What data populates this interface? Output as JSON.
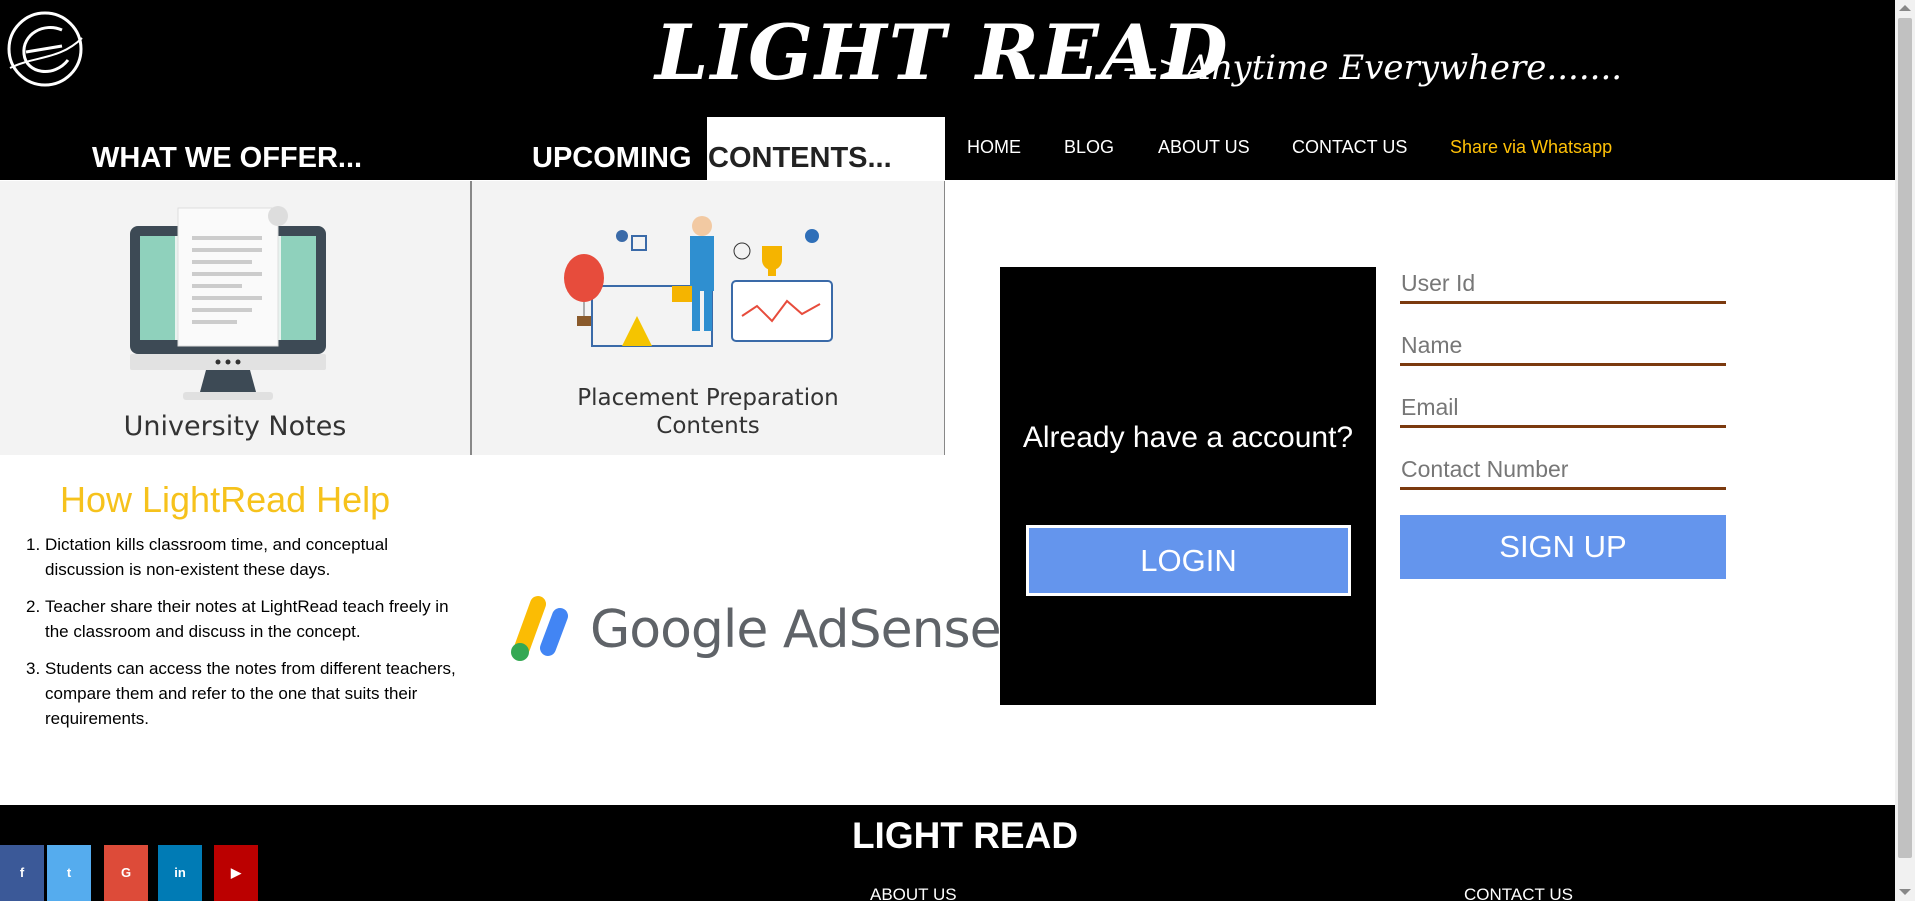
{
  "header": {
    "brand": "LIGHT READ",
    "tagline": "--->Anytime Everywhere.......",
    "offer_tab": "WHAT WE OFFER...",
    "upcoming_prefix": "UPCOMING",
    "upcoming_suffix": "CONTENTS...",
    "nav": [
      {
        "label": "HOME"
      },
      {
        "label": "BLOG"
      },
      {
        "label": "ABOUT US"
      },
      {
        "label": "CONTACT US"
      },
      {
        "label": "Share via Whatsapp"
      }
    ]
  },
  "cards": [
    {
      "label": "University Notes"
    },
    {
      "label_line1": "Placement Preparation",
      "label_line2": "Contents"
    }
  ],
  "help": {
    "title": "How LightRead Help",
    "items": [
      "Dictation kills classroom time, and conceptual discussion is non-existent these days.",
      "Teacher share their notes at LightRead teach freely in the classroom and discuss in the concept.",
      "Students can access the notes from different teachers, compare them and refer to the one that suits their requirements."
    ]
  },
  "adsense": {
    "text": "Google AdSense"
  },
  "login": {
    "question": "Already have a account?",
    "button": "LOGIN"
  },
  "signup": {
    "user_id_placeholder": "User Id",
    "name_placeholder": "Name",
    "email_placeholder": "Email",
    "contact_placeholder": "Contact Number",
    "button": "SIGN UP"
  },
  "footer": {
    "title": "LIGHT READ",
    "about": "ABOUT US",
    "contact": "CONTACT US"
  },
  "social": [
    {
      "icon": "facebook-icon",
      "glyph": "f",
      "color": "#3b5998"
    },
    {
      "icon": "twitter-icon",
      "glyph": "t",
      "color": "#55acee"
    },
    {
      "icon": "google-plus-icon",
      "glyph": "G",
      "color": "#dd4b39"
    },
    {
      "icon": "linkedin-icon",
      "glyph": "in",
      "color": "#007bb5"
    },
    {
      "icon": "youtube-icon",
      "glyph": "▶",
      "color": "#bb0000"
    }
  ],
  "colors": {
    "accent_yellow": "#f6c21c",
    "button_blue": "#6495ed",
    "field_underline": "#7b3a0e"
  }
}
